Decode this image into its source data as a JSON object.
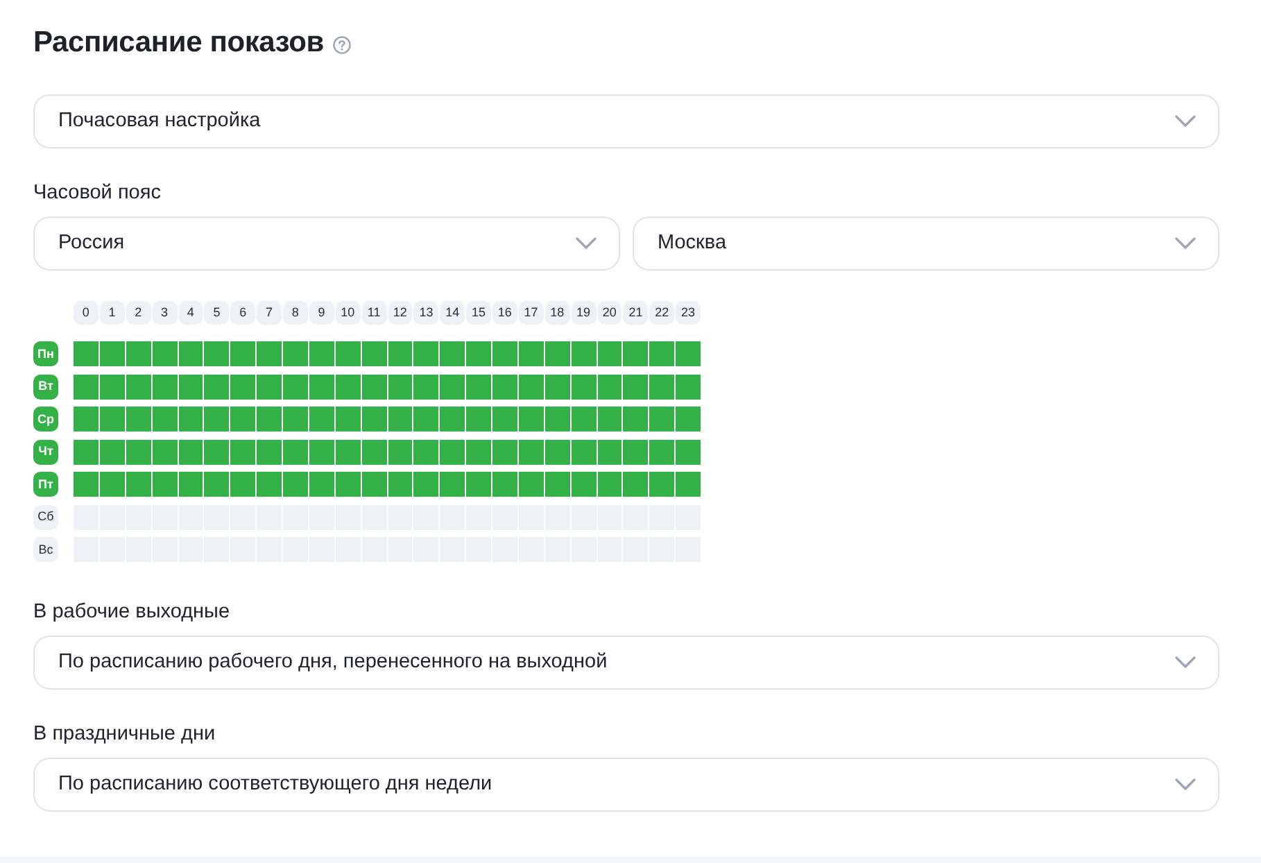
{
  "title": "Расписание показов",
  "mode_select": {
    "value": "Почасовая настройка"
  },
  "timezone": {
    "label": "Часовой пояс",
    "country": {
      "value": "Россия"
    },
    "city": {
      "value": "Москва"
    }
  },
  "schedule": {
    "hours": [
      "0",
      "1",
      "2",
      "3",
      "4",
      "5",
      "6",
      "7",
      "8",
      "9",
      "10",
      "11",
      "12",
      "13",
      "14",
      "15",
      "16",
      "17",
      "18",
      "19",
      "20",
      "21",
      "22",
      "23"
    ],
    "days": [
      {
        "label": "Пн",
        "enabled": true,
        "slots": [
          true,
          true,
          true,
          true,
          true,
          true,
          true,
          true,
          true,
          true,
          true,
          true,
          true,
          true,
          true,
          true,
          true,
          true,
          true,
          true,
          true,
          true,
          true,
          true
        ]
      },
      {
        "label": "Вт",
        "enabled": true,
        "slots": [
          true,
          true,
          true,
          true,
          true,
          true,
          true,
          true,
          true,
          true,
          true,
          true,
          true,
          true,
          true,
          true,
          true,
          true,
          true,
          true,
          true,
          true,
          true,
          true
        ]
      },
      {
        "label": "Ср",
        "enabled": true,
        "slots": [
          true,
          true,
          true,
          true,
          true,
          true,
          true,
          true,
          true,
          true,
          true,
          true,
          true,
          true,
          true,
          true,
          true,
          true,
          true,
          true,
          true,
          true,
          true,
          true
        ]
      },
      {
        "label": "Чт",
        "enabled": true,
        "slots": [
          true,
          true,
          true,
          true,
          true,
          true,
          true,
          true,
          true,
          true,
          true,
          true,
          true,
          true,
          true,
          true,
          true,
          true,
          true,
          true,
          true,
          true,
          true,
          true
        ]
      },
      {
        "label": "Пт",
        "enabled": true,
        "slots": [
          true,
          true,
          true,
          true,
          true,
          true,
          true,
          true,
          true,
          true,
          true,
          true,
          true,
          true,
          true,
          true,
          true,
          true,
          true,
          true,
          true,
          true,
          true,
          true
        ]
      },
      {
        "label": "Сб",
        "enabled": false,
        "slots": [
          false,
          false,
          false,
          false,
          false,
          false,
          false,
          false,
          false,
          false,
          false,
          false,
          false,
          false,
          false,
          false,
          false,
          false,
          false,
          false,
          false,
          false,
          false,
          false
        ]
      },
      {
        "label": "Вс",
        "enabled": false,
        "slots": [
          false,
          false,
          false,
          false,
          false,
          false,
          false,
          false,
          false,
          false,
          false,
          false,
          false,
          false,
          false,
          false,
          false,
          false,
          false,
          false,
          false,
          false,
          false,
          false
        ]
      }
    ]
  },
  "working_weekends": {
    "label": "В рабочие выходные",
    "value": "По расписанию рабочего дня, перенесенного на выходной"
  },
  "holidays": {
    "label": "В праздничные дни",
    "value": "По расписанию соответствующего дня недели"
  }
}
